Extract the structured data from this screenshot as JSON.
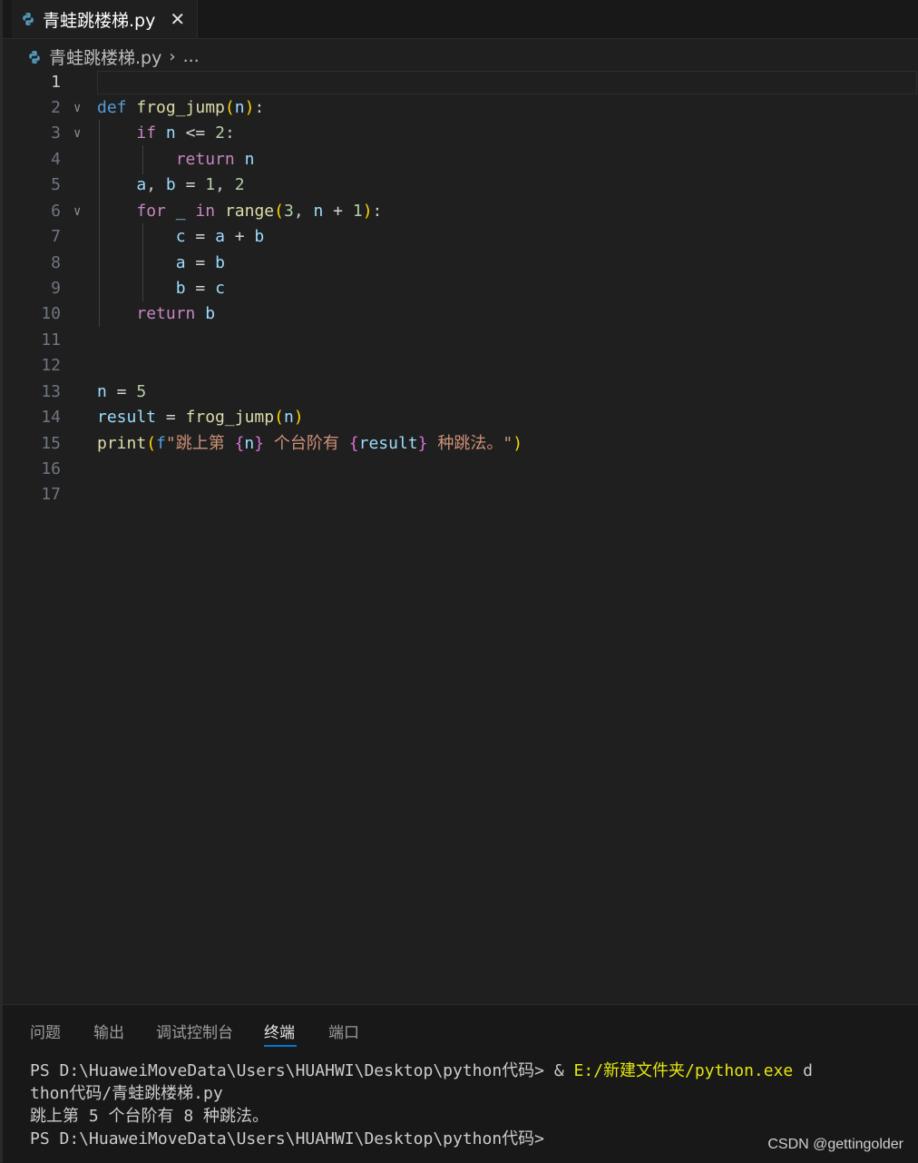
{
  "tab": {
    "filename": "青蛙跳楼梯.py",
    "close": "✕",
    "icon": "python-icon"
  },
  "breadcrumb": {
    "filename": "青蛙跳楼梯.py",
    "sep": "›",
    "rest": "..."
  },
  "colors": {
    "keyword": "#c586c0",
    "def": "#569cd6",
    "function": "#dcdcaa",
    "variable": "#9cdcfe",
    "number": "#b5cea8",
    "string": "#ce9178",
    "bracket1": "#ffd700",
    "bracket2": "#da70d6",
    "accent": "#0078d4"
  },
  "editor": {
    "line_numbers": [
      "1",
      "2",
      "3",
      "4",
      "5",
      "6",
      "7",
      "8",
      "9",
      "10",
      "11",
      "12",
      "13",
      "14",
      "15",
      "16",
      "17"
    ],
    "tokens": {
      "l2": {
        "def": "def",
        "fn": "frog_jump",
        "po": "(",
        "arg": "n",
        "pc": ")",
        "colon": ":"
      },
      "l3": {
        "kw": "if",
        "v": "n",
        "op": " <= ",
        "num": "2",
        "colon": ":"
      },
      "l4": {
        "kw": "return",
        "v": "n"
      },
      "l5": {
        "a": "a",
        "comma": ", ",
        "b": "b",
        "eq": " = ",
        "n1": "1",
        "comma2": ", ",
        "n2": "2"
      },
      "l6": {
        "kw": "for",
        "us": "_",
        "in": "in",
        "fn": "range",
        "po": "(",
        "n3": "3",
        "comma": ", ",
        "v": "n",
        "plus": " + ",
        "n1": "1",
        "pc": ")",
        "colon": ":"
      },
      "l7": {
        "c": "c",
        "eq": " = ",
        "a": "a",
        "plus": " + ",
        "b": "b"
      },
      "l8": {
        "a": "a",
        "eq": " = ",
        "b": "b"
      },
      "l9": {
        "b": "b",
        "eq": " = ",
        "c": "c"
      },
      "l10": {
        "kw": "return",
        "v": "b"
      },
      "l13": {
        "v": "n",
        "eq": " = ",
        "num": "5"
      },
      "l14": {
        "v": "result",
        "eq": " = ",
        "fn": "frog_jump",
        "po": "(",
        "arg": "n",
        "pc": ")"
      },
      "l15": {
        "fn": "print",
        "po": "(",
        "f": "f",
        "s1": "\"跳上第 ",
        "b1o": "{",
        "v1": "n",
        "b1c": "}",
        "s2": " 个台阶有 ",
        "b2o": "{",
        "v2": "result",
        "b2c": "}",
        "s3": " 种跳法。\"",
        "pc": ")"
      }
    }
  },
  "panel": {
    "tabs": [
      "问题",
      "输出",
      "调试控制台",
      "终端",
      "端口"
    ],
    "active_tab": "终端",
    "terminal": {
      "line1_prefix": "PS D:\\HuaweiMoveData\\Users\\HUAHWI\\Desktop\\python代码> & ",
      "line1_exe": "E:/新建文件夹/python.exe",
      "line1_suffix": " d",
      "line2": "thon代码/青蛙跳楼梯.py",
      "line3": "跳上第 5 个台阶有 8 种跳法。",
      "line4": "PS D:\\HuaweiMoveData\\Users\\HUAHWI\\Desktop\\python代码>"
    }
  },
  "watermark": "CSDN @gettingolder"
}
